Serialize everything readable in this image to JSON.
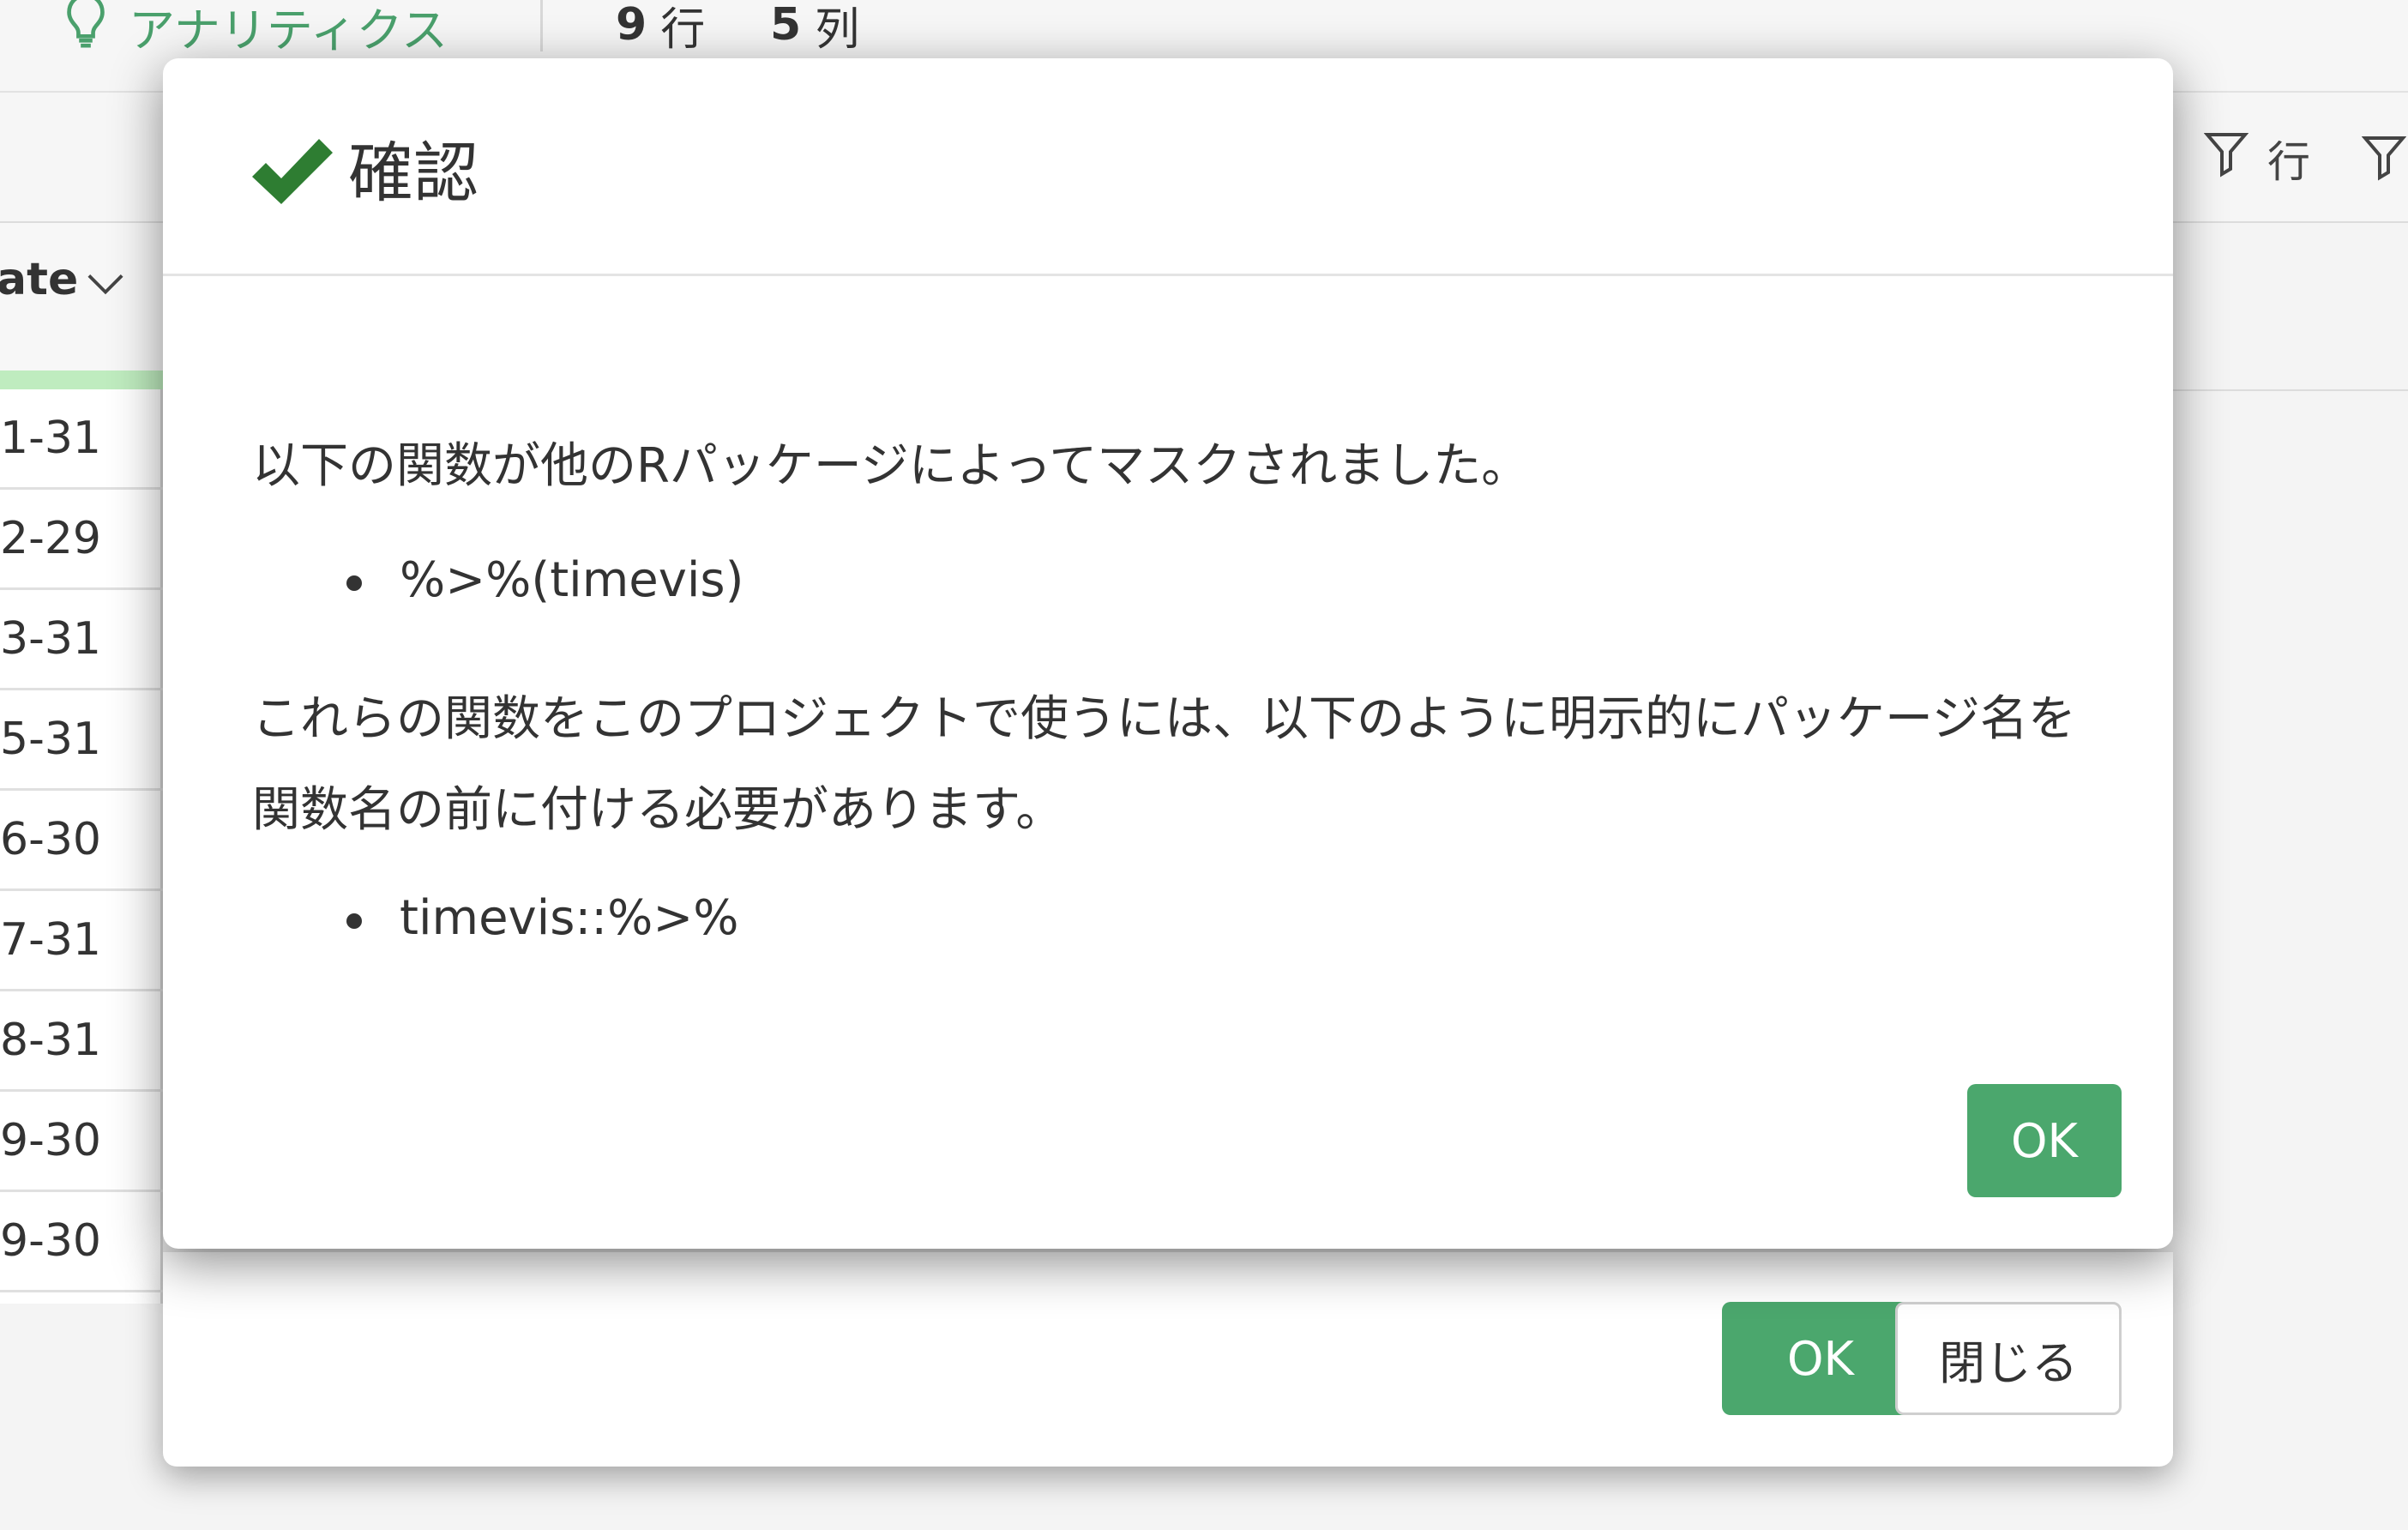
{
  "top_bar": {
    "analytics_tab_label": "アナリティクス",
    "row_count_value": "9",
    "row_count_unit": "行",
    "col_count_value": "5",
    "col_count_unit": "列"
  },
  "toolbar": {
    "filter_row_label": "行"
  },
  "grid": {
    "column_header": "ate",
    "rows": [
      "1-31",
      "2-29",
      "3-31",
      "5-31",
      "6-30",
      "7-31",
      "8-31",
      "9-30",
      "9-30"
    ]
  },
  "dialog": {
    "title": "確認",
    "message": "以下の関数が他のRパッケージによってマスクされました。",
    "masked_functions": [
      "%>%(timevis)"
    ],
    "instruction": "これらの関数をこのプロジェクトで使うには、以下のように明示的にパッケージ名を関数名の前に付ける必要があります。",
    "qualified_functions": [
      "timevis::%>%"
    ],
    "ok_label": "OK"
  },
  "back_dialog": {
    "ok_label": "OK",
    "close_label": "閉じる"
  },
  "colors": {
    "accent_green": "#4ba76d",
    "check_green": "#2e7d32"
  }
}
